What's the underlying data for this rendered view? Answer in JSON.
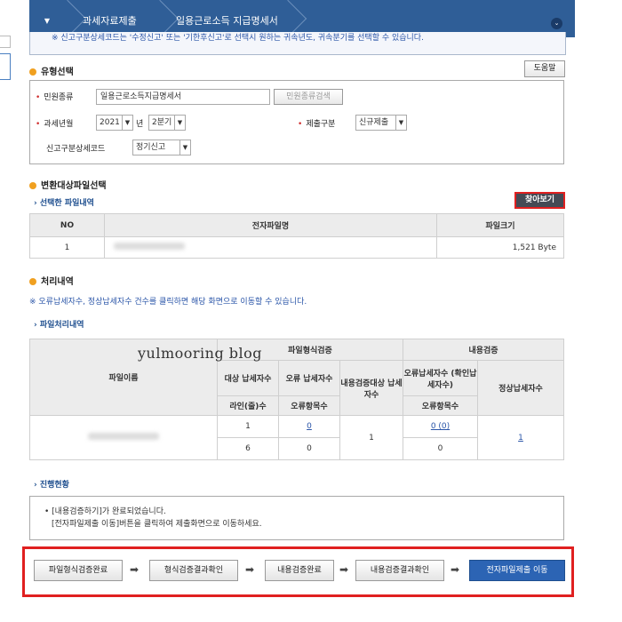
{
  "breadcrumb": {
    "items": [
      "과세자료제출",
      "일용근로소득 지급명세서"
    ]
  },
  "notice": "※ 신고구분상세코드는 '수정신고' 또는 '기한후신고'로 선택시 원하는 귀속년도, 귀속분기를 선택할 수 있습니다.",
  "type_section": {
    "title": "유형선택",
    "help_label": "도움말",
    "complaint_type_label": "민원종류",
    "complaint_type_value": "일용근로소득지급명세서",
    "complaint_search_label": "민원종류검색",
    "tax_period_label": "과세년월",
    "year_value": "2021",
    "year_suffix": "년",
    "quarter_value": "2분기",
    "submit_type_label": "제출구분",
    "submit_type_value": "신규제출",
    "report_code_label": "신고구분상세코드",
    "report_code_value": "정기신고"
  },
  "file_section": {
    "title": "변환대상파일선택",
    "subtitle": "선택한 파일내역",
    "browse_label": "찾아보기",
    "columns": [
      "NO",
      "전자파일명",
      "파일크기"
    ],
    "rows": [
      {
        "no": "1",
        "size": "1,521 Byte"
      }
    ]
  },
  "process_section": {
    "title": "처리내역",
    "note": "※ 오류납세자수, 정상납세자수 건수를 클릭하면 해당 화면으로 이동할 수 있습니다.",
    "subtitle": "파일처리내역",
    "header_filename": "파일이름",
    "header_format_check": "파일형식검증",
    "header_content_check": "내용검증",
    "header_target_taxpayers": "대상 납세자수",
    "header_error_taxpayers": "오류 납세자수",
    "header_content_target": "내용검증대상 납세자수",
    "header_error_taxpayers_confirm": "오류납세자수 (확인납세자수)",
    "header_normal_taxpayers": "정상납세자수",
    "header_lines": "라인(줄)수",
    "header_error_items": "오류항목수",
    "header_error_items2": "오류항목수",
    "row1_target": "1",
    "row1_error": "0",
    "content_target": "1",
    "row1_error_confirm": "0 (0)",
    "normal": "1",
    "row2_lines": "6",
    "row2_error_items": "0",
    "row2_error_items2": "0"
  },
  "progress_section": {
    "title": "진행현황",
    "line1": "[내용검증하기]가 완료되었습니다.",
    "line2": "[전자파일제출 이동]버튼을 클릭하여 제출화면으로 이동하세요."
  },
  "steps": [
    "파일형식검증완료",
    "형식검증결과확인",
    "내용검증완료",
    "내용검증결과확인",
    "전자파일제출 이동"
  ],
  "watermark": "yulmooring blog"
}
